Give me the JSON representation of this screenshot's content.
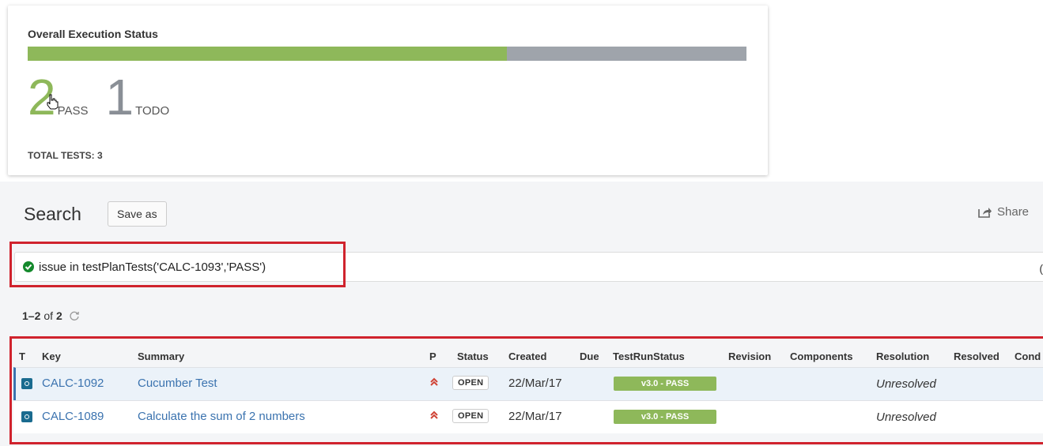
{
  "execution_status": {
    "title": "Overall Execution Status",
    "pass_count": "2",
    "pass_label": "PASS",
    "todo_count": "1",
    "todo_label": "TODO",
    "total_tests": "TOTAL TESTS: 3",
    "pass_fraction": 0.667,
    "colors": {
      "pass": "#8eb85a",
      "todo": "#9fa4ab"
    }
  },
  "search": {
    "title": "Search",
    "save_as_label": "Save as",
    "share_label": "Share",
    "query": "issue in testPlanTests('CALC-1093','PASS')",
    "results_prefix": "1–2",
    "results_of": "of",
    "results_total": "2"
  },
  "table": {
    "columns": {
      "type": "T",
      "key": "Key",
      "summary": "Summary",
      "priority": "P",
      "status": "Status",
      "created": "Created",
      "due": "Due",
      "testrunstatus": "TestRunStatus",
      "revision": "Revision",
      "components": "Components",
      "resolution": "Resolution",
      "resolved": "Resolved",
      "cond": "Cond"
    },
    "rows": [
      {
        "key": "CALC-1092",
        "summary": "Cucumber Test",
        "priority_icon": "double-chevron-up-icon",
        "status": "OPEN",
        "created": "22/Mar/17",
        "testrunstatus": "v3.0 - PASS",
        "resolution": "Unresolved"
      },
      {
        "key": "CALC-1089",
        "summary": "Calculate the sum of 2 numbers",
        "priority_icon": "double-chevron-up-icon",
        "status": "OPEN",
        "created": "22/Mar/17",
        "testrunstatus": "v3.0 - PASS",
        "resolution": "Unresolved"
      }
    ]
  },
  "colors": {
    "highlight": "#d0232d",
    "link": "#3b73af",
    "priority": "#d04437"
  }
}
